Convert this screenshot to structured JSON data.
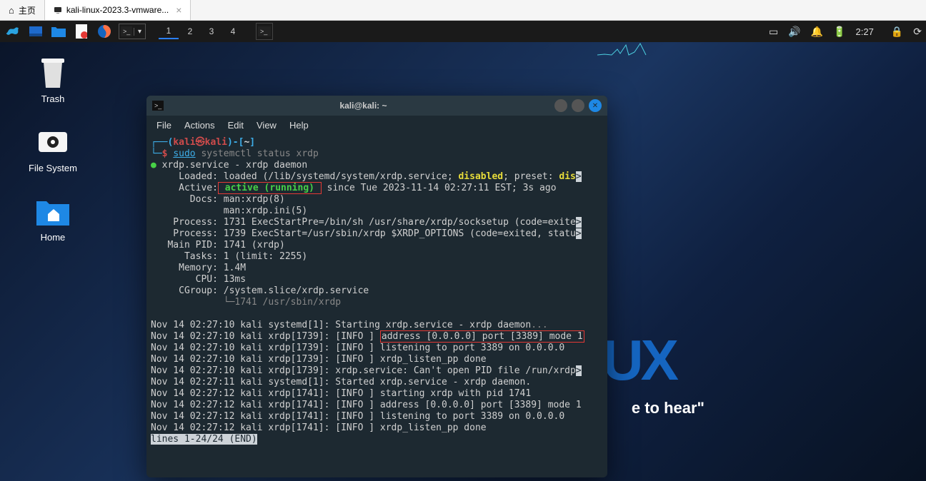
{
  "vmware": {
    "tab_home": "主页",
    "tab_vm": "kali-linux-2023.3-vmware..."
  },
  "taskbar": {
    "workspaces": [
      "1",
      "2",
      "3",
      "4"
    ],
    "clock": "2:27"
  },
  "desktop": {
    "trash": "Trash",
    "filesystem": "File System",
    "home": "Home",
    "bg_right": "UX",
    "bg_slogan": "e to hear\""
  },
  "terminal": {
    "title": "kali@kali: ~",
    "menu": {
      "file": "File",
      "actions": "Actions",
      "edit": "Edit",
      "view": "View",
      "help": "Help"
    },
    "prompt": {
      "box_open": "┌──(",
      "user": "kali",
      "at": "㉿",
      "host": "kali",
      "box_close": ")-[",
      "path": "~",
      "end": "]",
      "line2_prefix": "└─",
      "dollar": "$"
    },
    "cmd": {
      "sudo": "sudo",
      "rest": " systemctl status xrdp"
    },
    "out": {
      "dot": "●",
      "svc_line": " xrdp.service - xrdp daemon",
      "loaded_lbl": "     Loaded: ",
      "loaded_a": "loaded (/lib/systemd/system/xrdp.service; ",
      "disabled": "disabled",
      "loaded_b": "; preset: ",
      "preset_dis": "dis",
      "active_lbl": "     Active:",
      "active_val": " active (running) ",
      "active_rest": "since Tue 2023-11-14 02:27:11 EST; 3s ago",
      "docs1": "       Docs: man:xrdp(8)",
      "docs2": "             man:xrdp.ini(5)",
      "proc1_a": "    Process: 1731 ExecStartPre=/bin/sh /usr/share/xrdp/socksetup (code=exite",
      "proc2_a": "    Process: 1739 ExecStart=/usr/sbin/xrdp $XRDP_OPTIONS (code=exited, statu",
      "mainpid": "   Main PID: 1741 (xrdp)",
      "tasks": "      Tasks: 1 (limit: 2255)",
      "memory": "     Memory: 1.4M",
      "cpu": "        CPU: 13ms",
      "cgroup": "     CGroup: /system.slice/xrdp.service",
      "cgroup2": "             └─1741 /usr/sbin/xrdp",
      "log1": "Nov 14 02:27:10 kali systemd[1]: Starting xrdp.service - xrdp daemon",
      "log1_ellipsis": "...",
      "log2_a": "Nov 14 02:27:10 kali xrdp[1739]: [INFO ] ",
      "log2_b": "address [0.0.0.0] port [3389] mode 1",
      "log3": "Nov 14 02:27:10 kali xrdp[1739]: [INFO ] listening to port 3389 on 0.0.0.0",
      "log4": "Nov 14 02:27:10 kali xrdp[1739]: [INFO ] xrdp_listen_pp done",
      "log5_a": "Nov 14 02:27:10 kali xrdp[1739]: xrdp.service: Can't open PID file /run/xrdp",
      "log6": "Nov 14 02:27:11 kali systemd[1]: Started xrdp.service - xrdp daemon.",
      "log7": "Nov 14 02:27:12 kali xrdp[1741]: [INFO ] starting xrdp with pid 1741",
      "log8": "Nov 14 02:27:12 kali xrdp[1741]: [INFO ] address [0.0.0.0] port [3389] mode 1",
      "log9": "Nov 14 02:27:12 kali xrdp[1741]: [INFO ] listening to port 3389 on 0.0.0.0",
      "log10": "Nov 14 02:27:12 kali xrdp[1741]: [INFO ] xrdp_listen_pp done",
      "pager": "lines 1-24/24 (END)",
      "gt": ">"
    }
  }
}
